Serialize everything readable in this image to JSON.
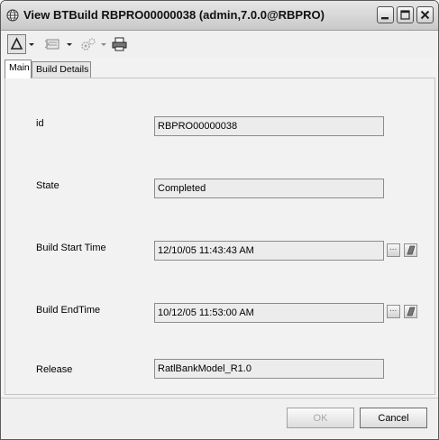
{
  "window": {
    "title": "View BTBuild RBPRO00000038 (admin,7.0.0@RBPRO)"
  },
  "tabs": [
    {
      "label": "Main",
      "active": true
    },
    {
      "label": "Build Details",
      "active": false
    }
  ],
  "form": {
    "fields": [
      {
        "label": "id",
        "value": "RBPRO00000038"
      },
      {
        "label": "State",
        "value": "Completed"
      },
      {
        "label": "Build Start Time",
        "value": "12/10/05 11:43:43 AM"
      },
      {
        "label": "Build EndTime",
        "value": "10/12/05 11:53:00 AM"
      },
      {
        "label": "Release",
        "value": "RatlBankModel_R1.0"
      }
    ],
    "ellipsis_label": "..."
  },
  "buttons": {
    "ok": "OK",
    "cancel": "Cancel"
  },
  "icons": {
    "app": "globe-icon",
    "toolbar": [
      "delta-action-icon",
      "dropdown-arrow-icon",
      "form-icon",
      "dropdown-arrow-icon",
      "gears-icon",
      "dropdown-arrow-icon",
      "printer-icon"
    ],
    "window_controls": [
      "minimize-icon",
      "maximize-icon",
      "close-icon"
    ],
    "field_actions": [
      "calendar-ellipsis-icon",
      "eraser-icon"
    ]
  },
  "colors": {
    "titlebar": "#d0d0d0",
    "field_background": "#ececec",
    "window_background": "#f2f2f2"
  }
}
